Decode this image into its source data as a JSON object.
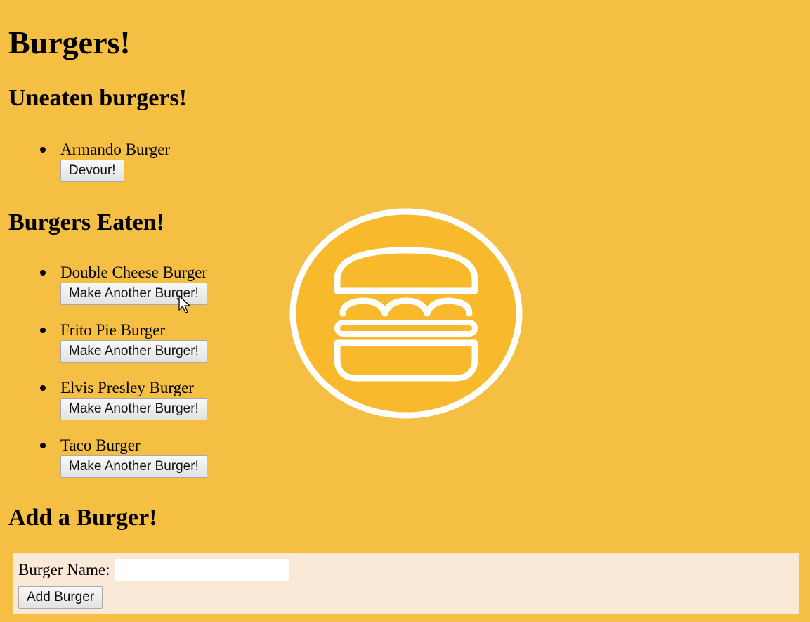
{
  "page": {
    "title": "Burgers!",
    "background": "#f4bf43"
  },
  "uneaten": {
    "heading": "Uneaten burgers!",
    "items": [
      {
        "name": "Armando Burger",
        "button": "Devour!"
      }
    ]
  },
  "eaten": {
    "heading": "Burgers Eaten!",
    "items": [
      {
        "name": "Double Cheese Burger",
        "button": "Make Another Burger!"
      },
      {
        "name": "Frito Pie Burger",
        "button": "Make Another Burger!"
      },
      {
        "name": "Elvis Presley Burger",
        "button": "Make Another Burger!"
      },
      {
        "name": "Taco Burger",
        "button": "Make Another Burger!"
      }
    ]
  },
  "add": {
    "heading": "Add a Burger!",
    "label": "Burger Name:",
    "input_value": "",
    "submit": "Add Burger",
    "form_background": "#fae9d6"
  },
  "logo": {
    "icon": "burger-logo-icon",
    "circle_color": "#f9b92c",
    "stroke_color": "#ffffff"
  }
}
